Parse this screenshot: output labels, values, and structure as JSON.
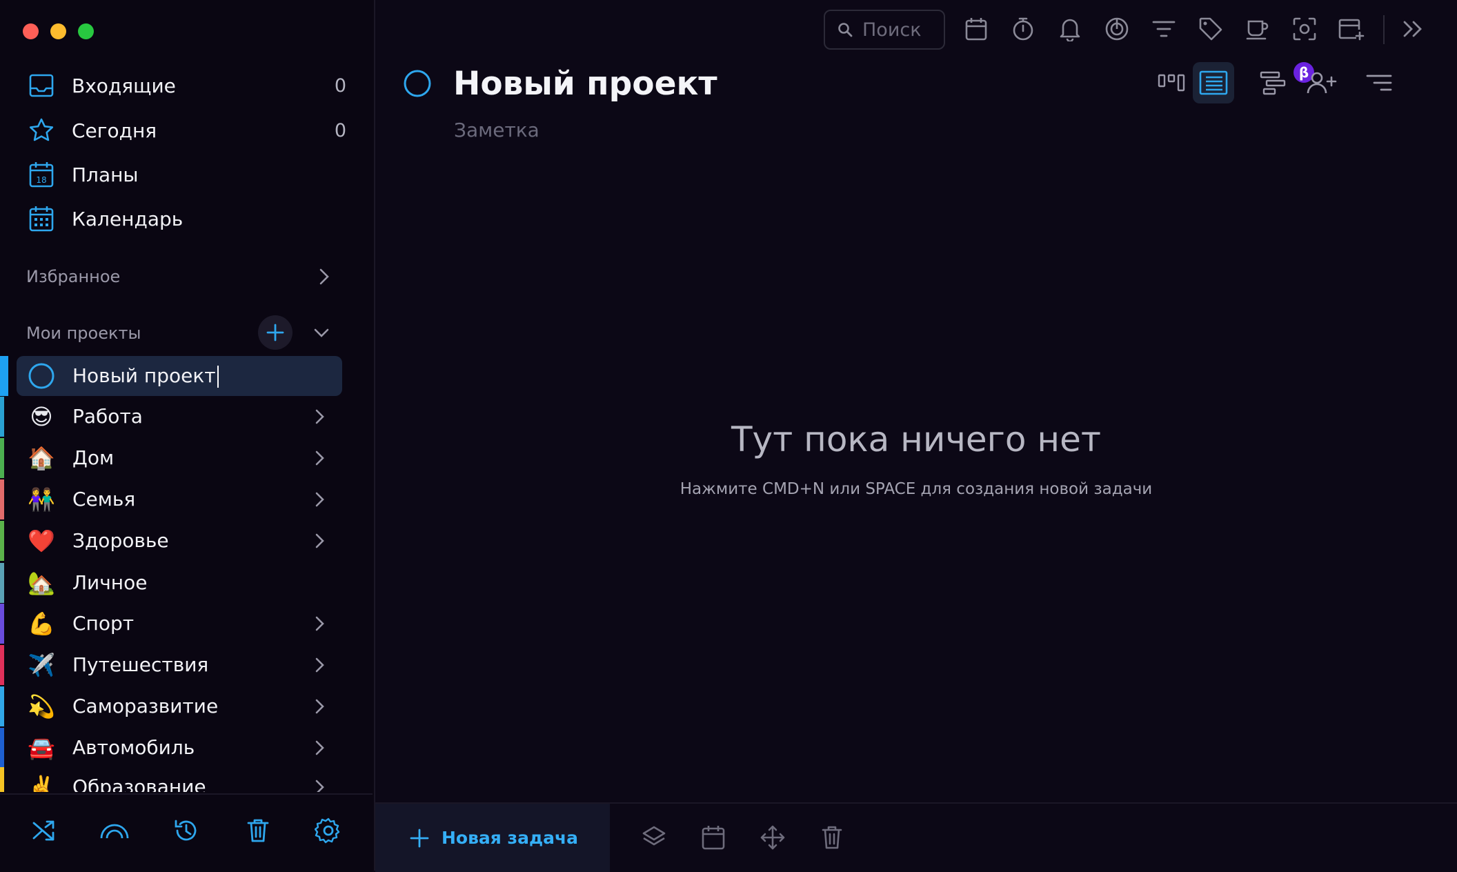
{
  "sidebar": {
    "nav": [
      {
        "label": "Входящие",
        "count": "0",
        "icon": "inbox-icon"
      },
      {
        "label": "Сегодня",
        "count": "0",
        "icon": "star-icon"
      },
      {
        "label": "Планы",
        "icon": "planner-calendar-icon",
        "icon_text": "18"
      },
      {
        "label": "Календарь",
        "icon": "calendar-grid-icon"
      }
    ],
    "favorites_label": "Избранное",
    "projects_label": "Мои проекты",
    "projects": [
      {
        "label": "Новый проект",
        "icon": "circle-icon",
        "color": "#1ea1f2",
        "active": true
      },
      {
        "label": "Работа",
        "emoji": "😎",
        "color": "#2aa1d2"
      },
      {
        "label": "Дом",
        "emoji": "🏠",
        "color": "#4caf50"
      },
      {
        "label": "Семья",
        "emoji": "👫",
        "color": "#e26b6b"
      },
      {
        "label": "Здоровье",
        "emoji": "❤️",
        "color": "#5bb24a"
      },
      {
        "label": "Личное",
        "emoji": "🏡",
        "color": "#5aa1b6"
      },
      {
        "label": "Спорт",
        "emoji": "💪",
        "color": "#6a4cdd"
      },
      {
        "label": "Путешествия",
        "emoji": "✈️",
        "color": "#e0305a"
      },
      {
        "label": "Саморазвитие",
        "emoji": "💫",
        "color": "#31a7e8"
      },
      {
        "label": "Автомобиль",
        "emoji": "🚘",
        "color": "#1e5fd0"
      },
      {
        "label": "Образование",
        "emoji": "✌️",
        "color": "#f5c324"
      }
    ]
  },
  "toolbar": {
    "search_placeholder": "Поиск"
  },
  "project": {
    "title": "Новый проект",
    "note_placeholder": "Заметка",
    "beta_badge": "β"
  },
  "empty_state": {
    "title": "Тут пока ничего нет",
    "hint": "Нажмите CMD+N или SPACE для создания новой задачи"
  },
  "bottom_bar": {
    "new_task_label": "Новая задача"
  },
  "colors": {
    "accent": "#1ea1f2",
    "background": "#0c0816",
    "sidebar": "#0a0612",
    "active_item": "#1c2740"
  }
}
